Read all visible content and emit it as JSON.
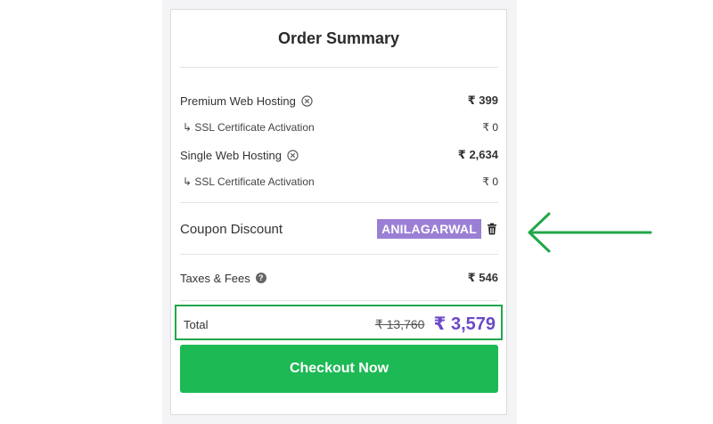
{
  "order_summary": {
    "title": "Order Summary",
    "items": [
      {
        "label": "Premium Web Hosting",
        "amount": "₹ 399",
        "removable": true
      },
      {
        "label": "↳ SSL Certificate Activation",
        "amount": "₹ 0",
        "removable": false
      },
      {
        "label": "Single Web Hosting",
        "amount": "₹ 2,634",
        "removable": true
      },
      {
        "label": "↳ SSL Certificate Activation",
        "amount": "₹ 0",
        "removable": false
      }
    ],
    "coupon": {
      "label": "Coupon Discount",
      "code": "ANILAGARWAL"
    },
    "taxes": {
      "label": "Taxes & Fees",
      "amount": "₹ 546"
    },
    "total": {
      "label": "Total",
      "original_price": "₹ 13,760",
      "price": "₹ 3,579"
    },
    "checkout_label": "Checkout Now"
  },
  "colors": {
    "accent_purple": "#6b49c7",
    "coupon_bg": "#9b7fd4",
    "checkout_green": "#1db954",
    "highlight_green": "#21a74a"
  },
  "icons": {
    "remove": "circle-x-icon",
    "delete_coupon": "trash-icon",
    "help": "question-circle-icon",
    "annotation": "arrow-left-icon"
  }
}
